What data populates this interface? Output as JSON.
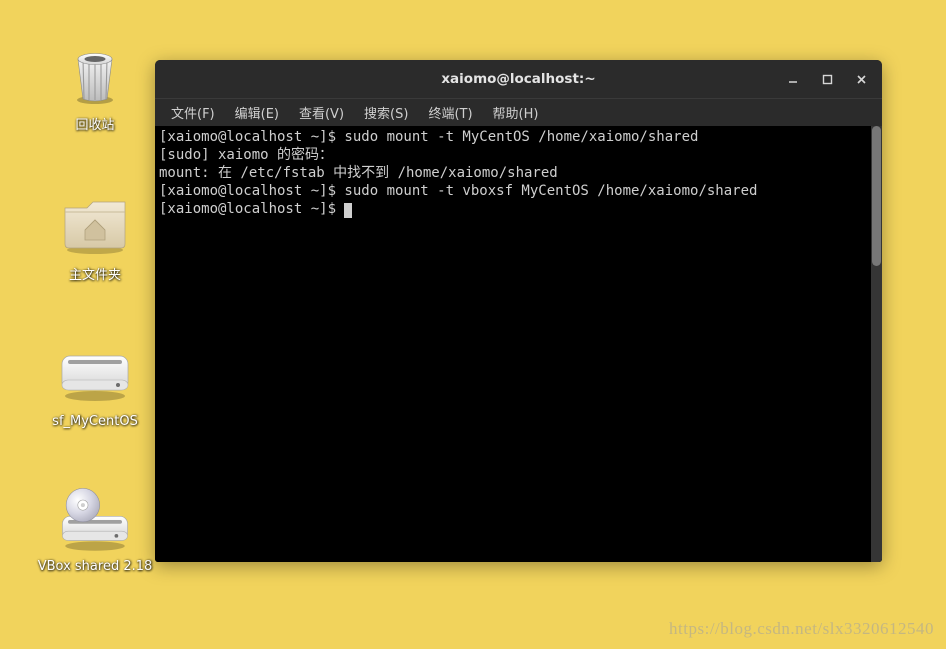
{
  "desktop": {
    "icons": [
      {
        "name": "trash",
        "label": "回收站"
      },
      {
        "name": "home-folder",
        "label": "主文件夹"
      },
      {
        "name": "shared-drive",
        "label": "sf_MyCentOS"
      },
      {
        "name": "vbox-drive",
        "label": "VBox shared 2.18"
      }
    ]
  },
  "terminal": {
    "title": "xaiomo@localhost:~",
    "window_controls": {
      "minimize": "–",
      "maximize": "▢",
      "close": "✕"
    },
    "menu": [
      {
        "key": "file",
        "label": "文件(F)"
      },
      {
        "key": "edit",
        "label": "编辑(E)"
      },
      {
        "key": "view",
        "label": "查看(V)"
      },
      {
        "key": "search",
        "label": "搜索(S)"
      },
      {
        "key": "terminal",
        "label": "终端(T)"
      },
      {
        "key": "help",
        "label": "帮助(H)"
      }
    ],
    "output": {
      "line1": "[xaiomo@localhost ~]$ sudo mount -t MyCentOS /home/xaiomo/shared",
      "line2": "[sudo] xaiomo 的密码：",
      "line3": "mount: 在 /etc/fstab 中找不到 /home/xaiomo/shared",
      "line4": "[xaiomo@localhost ~]$ sudo mount -t vboxsf MyCentOS /home/xaiomo/shared",
      "line5": "[xaiomo@localhost ~]$ "
    }
  },
  "watermark": "https://blog.csdn.net/slx3320612540"
}
